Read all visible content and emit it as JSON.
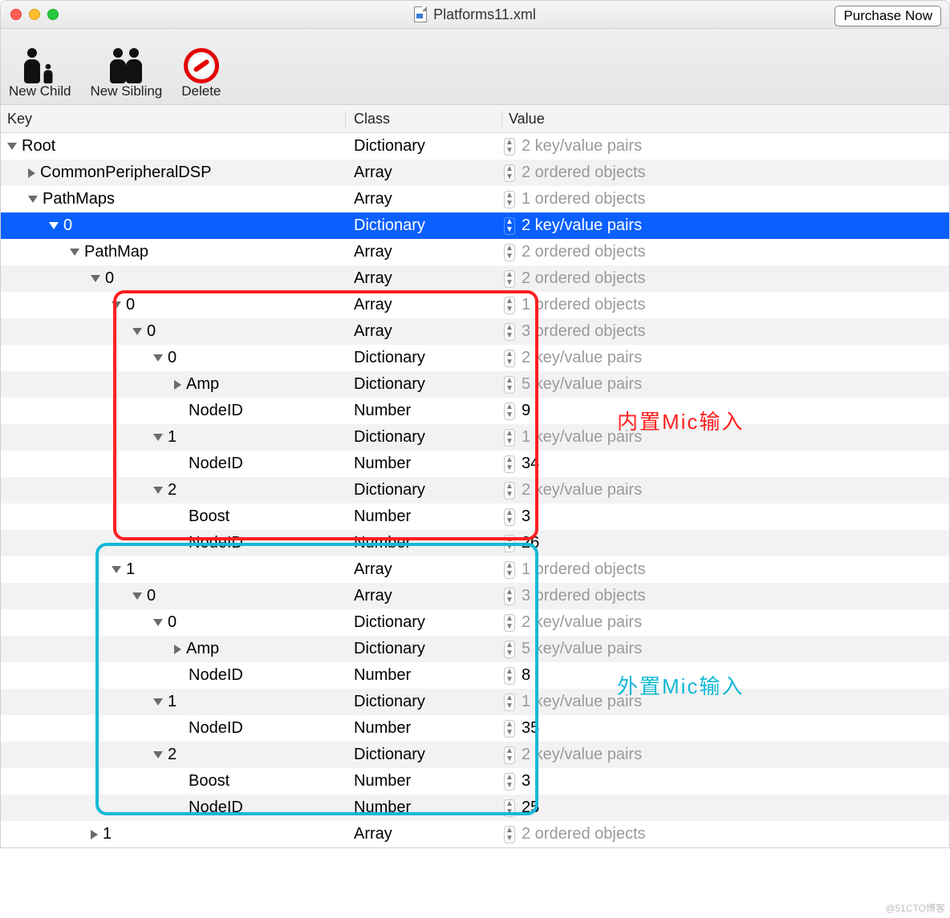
{
  "title": "Platforms11.xml",
  "purchase_label": "Purchase Now",
  "toolbar": {
    "new_child": "New Child",
    "new_sibling": "New Sibling",
    "delete": "Delete"
  },
  "columns": {
    "key": "Key",
    "class": "Class",
    "value": "Value"
  },
  "rows": [
    {
      "indent": 0,
      "disc": "open",
      "key": "Root",
      "class": "Dictionary",
      "value": "2 key/value pairs",
      "muted": true,
      "sel": false
    },
    {
      "indent": 1,
      "disc": "closed",
      "key": "CommonPeripheralDSP",
      "class": "Array",
      "value": "2 ordered objects",
      "muted": true,
      "sel": false
    },
    {
      "indent": 1,
      "disc": "open",
      "key": "PathMaps",
      "class": "Array",
      "value": "1 ordered objects",
      "muted": true,
      "sel": false
    },
    {
      "indent": 2,
      "disc": "open",
      "key": "0",
      "class": "Dictionary",
      "value": "2 key/value pairs",
      "muted": false,
      "sel": true
    },
    {
      "indent": 3,
      "disc": "open",
      "key": "PathMap",
      "class": "Array",
      "value": "2 ordered objects",
      "muted": true,
      "sel": false
    },
    {
      "indent": 4,
      "disc": "open",
      "key": "0",
      "class": "Array",
      "value": "2 ordered objects",
      "muted": true,
      "sel": false
    },
    {
      "indent": 5,
      "disc": "open",
      "key": "0",
      "class": "Array",
      "value": "1 ordered objects",
      "muted": true,
      "sel": false
    },
    {
      "indent": 6,
      "disc": "open",
      "key": "0",
      "class": "Array",
      "value": "3 ordered objects",
      "muted": true,
      "sel": false
    },
    {
      "indent": 7,
      "disc": "open",
      "key": "0",
      "class": "Dictionary",
      "value": "2 key/value pairs",
      "muted": true,
      "sel": false
    },
    {
      "indent": 8,
      "disc": "closed",
      "key": "Amp",
      "class": "Dictionary",
      "value": "5 key/value pairs",
      "muted": true,
      "sel": false
    },
    {
      "indent": 8,
      "disc": "none",
      "key": "NodeID",
      "class": "Number",
      "value": "9",
      "muted": false,
      "sel": false
    },
    {
      "indent": 7,
      "disc": "open",
      "key": "1",
      "class": "Dictionary",
      "value": "1 key/value pairs",
      "muted": true,
      "sel": false
    },
    {
      "indent": 8,
      "disc": "none",
      "key": "NodeID",
      "class": "Number",
      "value": "34",
      "muted": false,
      "sel": false
    },
    {
      "indent": 7,
      "disc": "open",
      "key": "2",
      "class": "Dictionary",
      "value": "2 key/value pairs",
      "muted": true,
      "sel": false
    },
    {
      "indent": 8,
      "disc": "none",
      "key": "Boost",
      "class": "Number",
      "value": "3",
      "muted": false,
      "sel": false
    },
    {
      "indent": 8,
      "disc": "none",
      "key": "NodeID",
      "class": "Number",
      "value": "26",
      "muted": false,
      "sel": false
    },
    {
      "indent": 5,
      "disc": "open",
      "key": "1",
      "class": "Array",
      "value": "1 ordered objects",
      "muted": true,
      "sel": false
    },
    {
      "indent": 6,
      "disc": "open",
      "key": "0",
      "class": "Array",
      "value": "3 ordered objects",
      "muted": true,
      "sel": false
    },
    {
      "indent": 7,
      "disc": "open",
      "key": "0",
      "class": "Dictionary",
      "value": "2 key/value pairs",
      "muted": true,
      "sel": false
    },
    {
      "indent": 8,
      "disc": "closed",
      "key": "Amp",
      "class": "Dictionary",
      "value": "5 key/value pairs",
      "muted": true,
      "sel": false
    },
    {
      "indent": 8,
      "disc": "none",
      "key": "NodeID",
      "class": "Number",
      "value": "8",
      "muted": false,
      "sel": false
    },
    {
      "indent": 7,
      "disc": "open",
      "key": "1",
      "class": "Dictionary",
      "value": "1 key/value pairs",
      "muted": true,
      "sel": false
    },
    {
      "indent": 8,
      "disc": "none",
      "key": "NodeID",
      "class": "Number",
      "value": "35",
      "muted": false,
      "sel": false
    },
    {
      "indent": 7,
      "disc": "open",
      "key": "2",
      "class": "Dictionary",
      "value": "2 key/value pairs",
      "muted": true,
      "sel": false
    },
    {
      "indent": 8,
      "disc": "none",
      "key": "Boost",
      "class": "Number",
      "value": "3",
      "muted": false,
      "sel": false
    },
    {
      "indent": 8,
      "disc": "none",
      "key": "NodeID",
      "class": "Number",
      "value": "25",
      "muted": false,
      "sel": false
    },
    {
      "indent": 4,
      "disc": "closed",
      "key": "1",
      "class": "Array",
      "value": "2 ordered objects",
      "muted": true,
      "sel": false
    }
  ],
  "annotations": {
    "red_label": "内置Mic输入",
    "cyan_label": "外置Mic输入"
  },
  "watermark": "@51CTO博客"
}
